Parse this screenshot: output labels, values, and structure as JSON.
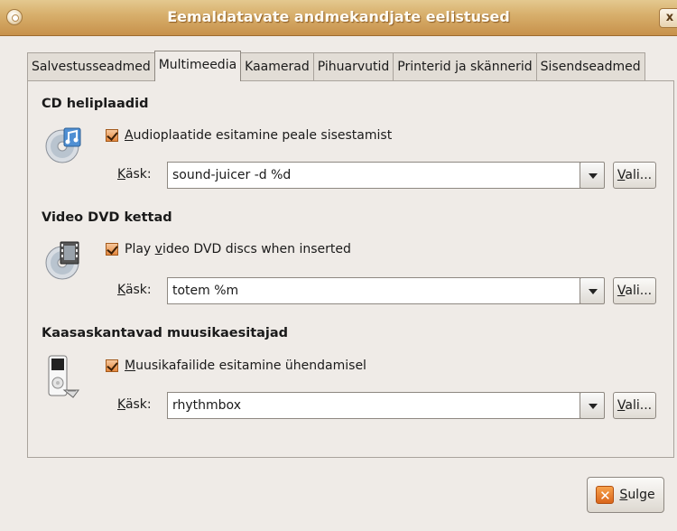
{
  "window": {
    "title": "Eemaldatavate andmekandjate eelistused",
    "close_label": "x"
  },
  "tabs": [
    {
      "label": "Salvestusseadmed"
    },
    {
      "label": "Multimeedia"
    },
    {
      "label": "Kaamerad"
    },
    {
      "label": "Pihuarvutid"
    },
    {
      "label": "Printerid ja skännerid"
    },
    {
      "label": "Sisendseadmed"
    }
  ],
  "sections": {
    "cd": {
      "title": "CD heliplaadid",
      "checkbox_label_prefix": "",
      "checkbox_mnemonic": "A",
      "checkbox_label_rest": "udioplaatide esitamine peale sisestamist",
      "checked": true,
      "command_label_mnemonic": "K",
      "command_label_rest": "äsk:",
      "command_value": "sound-juicer -d %d",
      "choose_mnemonic": "V",
      "choose_rest": "ali...",
      "icon": "audio-cd-icon"
    },
    "dvd": {
      "title": "Video DVD kettad",
      "checkbox_label_prefix": "Play ",
      "checkbox_mnemonic": "v",
      "checkbox_label_rest": "ideo DVD discs when inserted",
      "checked": true,
      "command_label_mnemonic": "K",
      "command_label_rest": "äsk:",
      "command_value": "totem %m",
      "choose_mnemonic": "V",
      "choose_rest": "ali...",
      "icon": "video-dvd-icon"
    },
    "player": {
      "title": "Kaasaskantavad muusikaesitajad",
      "checkbox_label_prefix": "",
      "checkbox_mnemonic": "M",
      "checkbox_label_rest": "uusikafailide esitamine ühendamisel",
      "checked": true,
      "command_label_mnemonic": "K",
      "command_label_rest": "äsk:",
      "command_value": "rhythmbox",
      "choose_mnemonic": "V",
      "choose_rest": "ali...",
      "icon": "music-player-icon"
    }
  },
  "footer": {
    "close_mnemonic": "S",
    "close_rest": "ulge"
  }
}
